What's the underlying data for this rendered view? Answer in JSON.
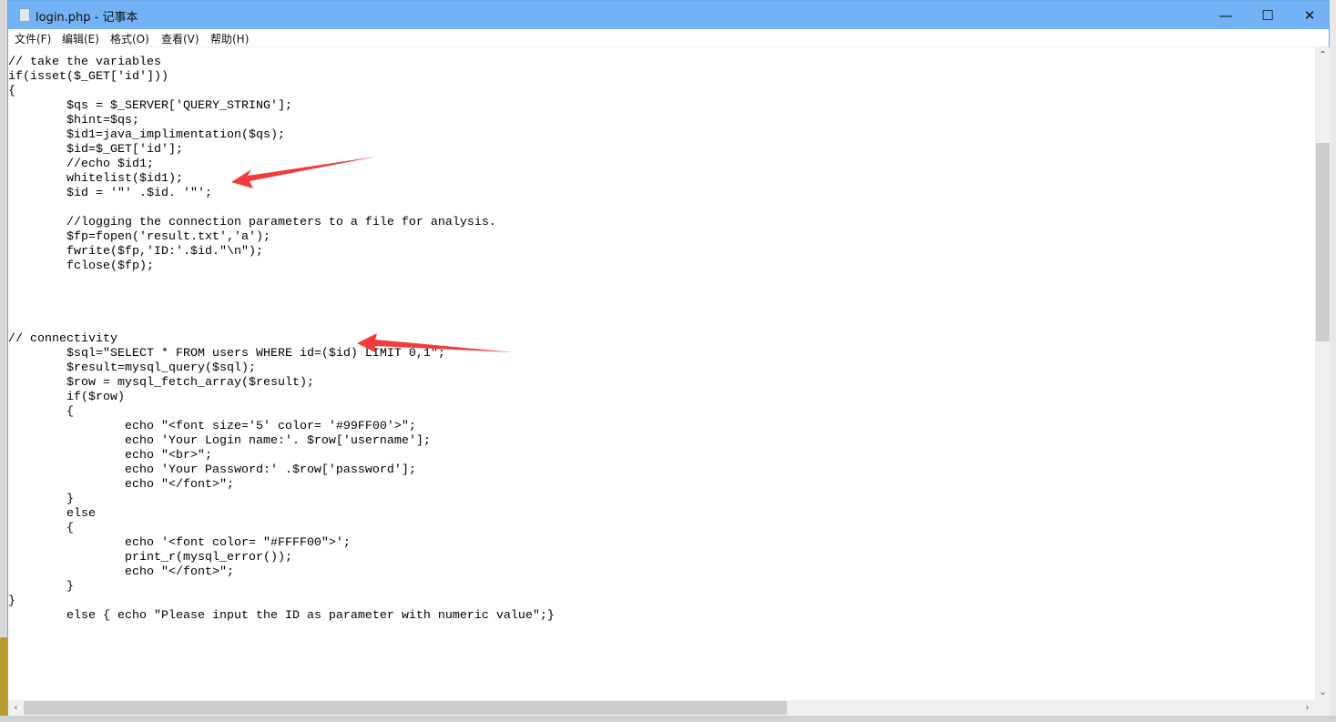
{
  "window": {
    "title": "login.php - 记事本",
    "controls": {
      "minimize": "—",
      "maximize": "☐",
      "close": "✕"
    }
  },
  "menu": [
    "文件(F)",
    "编辑(E)",
    "格式(O)",
    "查看(V)",
    "帮助(H)"
  ],
  "editor": {
    "lines": [
      "// take the variables",
      "if(isset($_GET['id']))",
      "{",
      "\t$qs = $_SERVER['QUERY_STRING'];",
      "\t$hint=$qs;",
      "\t$id1=java_implimentation($qs);",
      "\t$id=$_GET['id'];",
      "\t//echo $id1;",
      "\twhitelist($id1);",
      "\t$id = '\"' .$id. '\"';",
      "",
      "\t//logging the connection parameters to a file for analysis.",
      "\t$fp=fopen('result.txt','a');",
      "\tfwrite($fp,'ID:'.$id.\"\\n\");",
      "\tfclose($fp);",
      "",
      "",
      "",
      "",
      "// connectivity",
      "\t$sql=\"SELECT * FROM users WHERE id=($id) LIMIT 0,1\";",
      "\t$result=mysql_query($sql);",
      "\t$row = mysql_fetch_array($result);",
      "\tif($row)",
      "\t{",
      "\t\techo \"<font size='5' color= '#99FF00'>\";",
      "\t\techo 'Your Login name:'. $row['username'];",
      "\t\techo \"<br>\";",
      "\t\techo 'Your Password:' .$row['password'];",
      "\t\techo \"</font>\";",
      "\t}",
      "\telse",
      "\t{",
      "\t\techo '<font color= \"#FFFF00\">';",
      "\t\tprint_r(mysql_error());",
      "\t\techo \"</font>\";",
      "\t}",
      "}",
      "\telse { echo \"Please input the ID as parameter with numeric value\";}"
    ]
  },
  "scrollbars": {
    "up": "⌃",
    "down": "⌄",
    "left": "‹",
    "right": "›"
  },
  "colors": {
    "titlebar": "#73b2f5",
    "annotation_arrow": "#f03c3c"
  }
}
